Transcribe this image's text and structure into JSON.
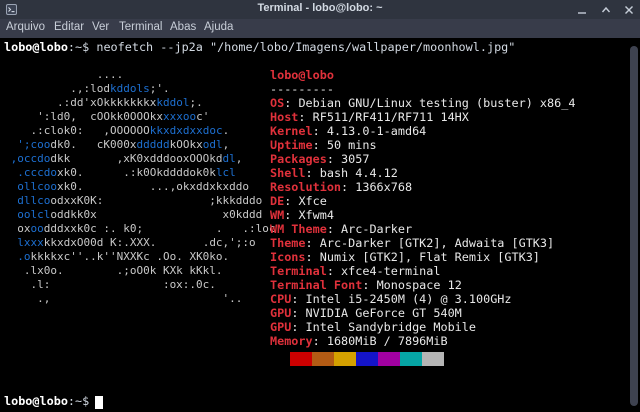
{
  "window": {
    "title": "Terminal - lobo@lobo: ~"
  },
  "menu": [
    "Arquivo",
    "Editar",
    "Ver",
    "Terminal",
    "Abas",
    "Ajuda"
  ],
  "command": {
    "user_host": "lobo@lobo",
    "suffix": ":~$",
    "text": " neofetch --jp2a \"/home/lobo/Imagens/wallpaper/moonhowl.jpg\""
  },
  "logo": {
    "lines": [
      "              ....",
      "          .,:lod",
      "        .:dd'x",
      "     ':ld0,  c",
      "    .:clok0:   ,",
      "  ';",
      "",
      "",
      "",
      "",
      "",
      "ox",
      "",
      "  .lx0o.",
      "    .l:",
      "    .,"
    ],
    "lines_b": [
      "kddols;'.",
      "Okkkkkkkx",
      "OOkk0OOOkx",
      "OOOOOO",
      "cK000x",
      "",
      "",
      "",
      "",
      "",
      "",
      "",
      "",
      "",
      ""
    ],
    "rows": [
      [
        [
          "c0",
          "              .... "
        ]
      ],
      [
        [
          "c0",
          "          .,:lod"
        ],
        [
          "c1",
          "kddols"
        ],
        [
          "c0",
          ";'."
        ]
      ],
      [
        [
          "c0",
          "        .:dd'x"
        ],
        [
          "c0",
          "Okkkkkkkx"
        ],
        [
          "c1",
          "kddol"
        ],
        [
          "c0",
          ";."
        ]
      ],
      [
        [
          "c0",
          "     ':ld0,  c"
        ],
        [
          "c0",
          "OOkk0OOOkx"
        ],
        [
          "c1",
          "xxxoo"
        ],
        [
          "c0",
          "c'"
        ]
      ],
      [
        [
          "c0",
          "    .:clok0:   ,"
        ],
        [
          "c0",
          "OOOOOO"
        ],
        [
          "c1",
          "kkxdxdxxdoc"
        ],
        [
          "c0",
          "."
        ]
      ],
      [
        [
          "c1",
          "  ';coo"
        ],
        [
          "c0",
          "dk0.   "
        ],
        [
          "c0",
          "cK000x"
        ],
        [
          "c1",
          "ddddd"
        ],
        [
          "c0",
          "kOOkx"
        ],
        [
          "c1",
          "odl"
        ],
        [
          "c0",
          ","
        ]
      ],
      [
        [
          "c1",
          " ,occdo"
        ],
        [
          "c0",
          "dkk       ,xK0xdddooxOOOkd"
        ],
        [
          "c1",
          "dl"
        ],
        [
          "c0",
          ","
        ]
      ],
      [
        [
          "c1",
          "  .cccdo"
        ],
        [
          "c0",
          "xk0.      .:k0Okddddok0k"
        ],
        [
          "c1",
          "lcl"
        ]
      ],
      [
        [
          "c1",
          "  ollcoo"
        ],
        [
          "c0",
          "xk0.          ...,okxddxkxddo"
        ]
      ],
      [
        [
          "c1",
          "  dllco"
        ],
        [
          "c0",
          "odxxK0K:                ;kkkdddo"
        ]
      ],
      [
        [
          "c1",
          "  oolcl"
        ],
        [
          "c0",
          "oddkk0x                   x0kddd"
        ]
      ],
      [
        [
          "c0",
          "  ox"
        ],
        [
          "c1",
          "oo"
        ],
        [
          "c0",
          "dddxxk0c :. k0;           .   .:loc"
        ]
      ],
      [
        [
          "c1",
          "  lxxx"
        ],
        [
          "c0",
          "kkxdxO00d K:.XXX.       .dc,';:o"
        ]
      ],
      [
        [
          "c1",
          "  .o"
        ],
        [
          "c0",
          "kkkkxc''..k''NXXKc .Oo. XK0ko."
        ]
      ],
      [
        [
          "c0",
          "   .lx0o.        .;oO0k KXk kKkl."
        ]
      ],
      [
        [
          "c0",
          "    .l:                 :ox:.0c."
        ]
      ],
      [
        [
          "c0",
          "     .,                          '.."
        ]
      ]
    ]
  },
  "info": {
    "title": "lobo@lobo",
    "separator": "---------",
    "fields": [
      {
        "key": "OS",
        "value": "Debian GNU/Linux testing (buster) x86_4"
      },
      {
        "key": "Host",
        "value": "RF511/RF411/RF711 14HX"
      },
      {
        "key": "Kernel",
        "value": "4.13.0-1-amd64"
      },
      {
        "key": "Uptime",
        "value": "50 mins"
      },
      {
        "key": "Packages",
        "value": "3057"
      },
      {
        "key": "Shell",
        "value": "bash 4.4.12"
      },
      {
        "key": "Resolution",
        "value": "1366x768"
      },
      {
        "key": "DE",
        "value": "Xfce"
      },
      {
        "key": "WM",
        "value": "Xfwm4"
      },
      {
        "key": "WM Theme",
        "value": "Arc-Darker"
      },
      {
        "key": "Theme",
        "value": "Arc-Darker [GTK2], Adwaita [GTK3]"
      },
      {
        "key": "Icons",
        "value": "Numix [GTK2], Flat Remix [GTK3]"
      },
      {
        "key": "Terminal",
        "value": "xfce4-terminal"
      },
      {
        "key": "Terminal Font",
        "value": "Monospace 12"
      },
      {
        "key": "CPU",
        "value": "Intel i5-2450M (4) @ 3.100GHz"
      },
      {
        "key": "GPU",
        "value": "NVIDIA GeForce GT 540M"
      },
      {
        "key": "GPU",
        "value": "Intel Sandybridge Mobile"
      },
      {
        "key": "Memory",
        "value": "1680MiB / 7896MiB"
      }
    ],
    "palette": [
      "#000000",
      "#cc0000",
      "#b35b14",
      "#d4a000",
      "#1414c8",
      "#a000a0",
      "#06a5a5",
      "#b5b5b5"
    ]
  },
  "prompt": {
    "user_host": "lobo@lobo",
    "suffix": ":~$"
  }
}
